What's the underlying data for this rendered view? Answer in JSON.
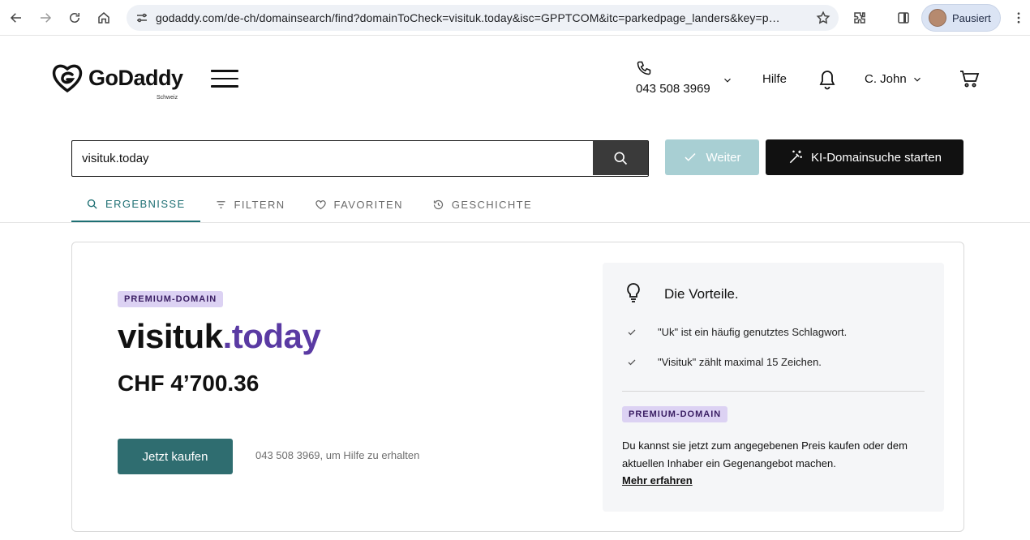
{
  "browser": {
    "url": "godaddy.com/de-ch/domainsearch/find?domainToCheck=visituk.today&isc=GPPTCOM&itc=parkedpage_landers&key=p…",
    "profile_label": "Pausiert"
  },
  "header": {
    "logo_text": "GoDaddy",
    "logo_sub": "Schweiz",
    "phone": "043 508 3969",
    "help": "Hilfe",
    "user": "C. John"
  },
  "search": {
    "value": "visituk.today",
    "weiter_label": "Weiter",
    "ki_label": "KI-Domainsuche starten"
  },
  "tabs": [
    {
      "label": "ERGEBNISSE",
      "icon": "search-icon",
      "active": true
    },
    {
      "label": "FILTERN",
      "icon": "filter-icon",
      "active": false
    },
    {
      "label": "FAVORITEN",
      "icon": "heart-icon",
      "active": false
    },
    {
      "label": "GESCHICHTE",
      "icon": "history-icon",
      "active": false
    }
  ],
  "result": {
    "badge": "PREMIUM-DOMAIN",
    "domain_name": "visituk",
    "domain_tld": ".today",
    "price": "CHF 4’700.36",
    "buy_label": "Jetzt kaufen",
    "help_text": "043 508 3969, um Hilfe zu erhalten"
  },
  "benefits": {
    "title": "Die Vorteile.",
    "items": [
      "\"Uk\" ist ein häufig genutztes Schlagwort.",
      "\"Visituk\" zählt maximal 15 Zeichen."
    ],
    "badge": "PREMIUM-DOMAIN",
    "text": "Du kannst sie jetzt zum angegebenen Preis kaufen oder dem aktuellen Inhaber ein Gegenangebot machen.",
    "more_link": "Mehr erfahren"
  },
  "colors": {
    "accent": "#2f6d70",
    "tld": "#5a3aa3",
    "badge_bg": "#dcd2f3"
  }
}
